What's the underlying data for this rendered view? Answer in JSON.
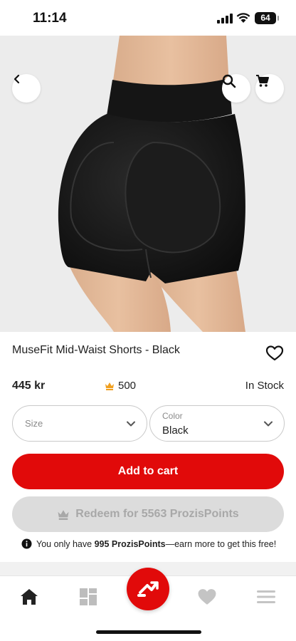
{
  "status_bar": {
    "time": "11:14",
    "battery": "64"
  },
  "hero": {
    "image_count": 12,
    "active_index": 0
  },
  "product": {
    "title": "MuseFit Mid-Waist Shorts - Black",
    "price": "445 kr",
    "points": "500",
    "stock": "In Stock"
  },
  "options": {
    "size_placeholder": "Size",
    "color_label": "Color",
    "color_value": "Black"
  },
  "actions": {
    "add_to_cart": "Add to cart",
    "redeem": "Redeem for 5563 ProzisPoints"
  },
  "info": {
    "prefix": "You only have",
    "points_owned": "995 ProzisPoints",
    "suffix": "—earn more to get this free!"
  },
  "icons": {
    "back": "chevron-left-icon",
    "search": "search-icon",
    "cart": "cart-icon",
    "favorite": "heart-outline-icon",
    "points": "crown-icon",
    "info": "info-icon",
    "nav_home": "home-icon",
    "nav_categories": "grid-icon",
    "nav_center": "prozis-logo-icon",
    "nav_wishlist": "heart-icon",
    "nav_menu": "menu-icon"
  },
  "colors": {
    "accent": "#e10a0a",
    "disabled_bg": "#dcdcdc",
    "disabled_text": "#a8a8a8",
    "crown": "#f0a020"
  }
}
